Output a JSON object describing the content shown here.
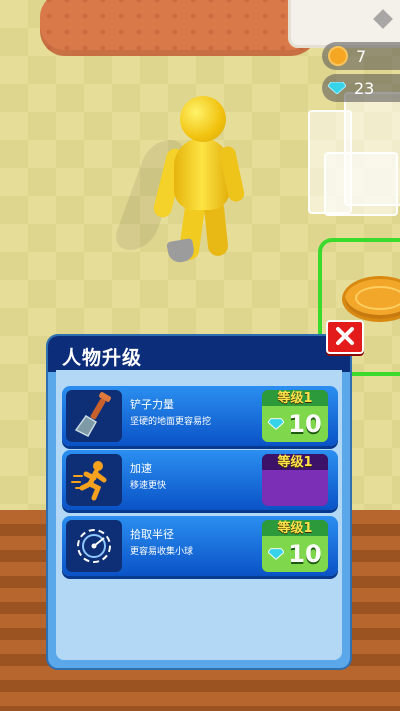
{
  "hud": {
    "coins": "7",
    "gems": "23"
  },
  "panel": {
    "title": "人物升级"
  },
  "upgrades": [
    {
      "name": "铲子力量",
      "description": "坚硬的地面更容易挖",
      "level": "等级1",
      "price": "10",
      "icon": "shovel-icon"
    },
    {
      "name": "加速",
      "description": "移速更快",
      "level": "等级1",
      "price": "",
      "icon": "running-man-icon"
    },
    {
      "name": "拾取半径",
      "description": "更容易收集小球",
      "level": "等级1",
      "price": "10",
      "icon": "radius-icon"
    }
  ],
  "colors": {
    "panel_header": "#0c2d7a",
    "row_blue": "#1f73e0",
    "price_green": "#7fd84b",
    "price_purple": "#7a2fb6",
    "close_red": "#e41b1b",
    "zone_green": "#3adb2d"
  }
}
